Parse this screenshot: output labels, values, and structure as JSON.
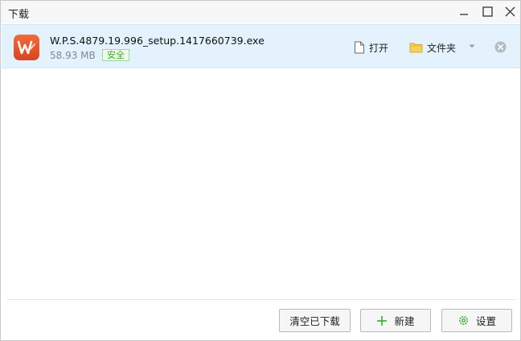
{
  "window": {
    "title": "下载"
  },
  "download": {
    "file_name": "W.P.S.4879.19.996_setup.1417660739.exe",
    "file_size": "58.93 MB",
    "badge": "安全",
    "open_label": "打开",
    "folder_label": "文件夹"
  },
  "footer": {
    "clear_label": "清空已下载",
    "new_label": "新建",
    "settings_label": "设置"
  },
  "colors": {
    "row_highlight": "#e3f2fc",
    "safe_green": "#3ea53a",
    "wps_orange": "#e5512a"
  }
}
